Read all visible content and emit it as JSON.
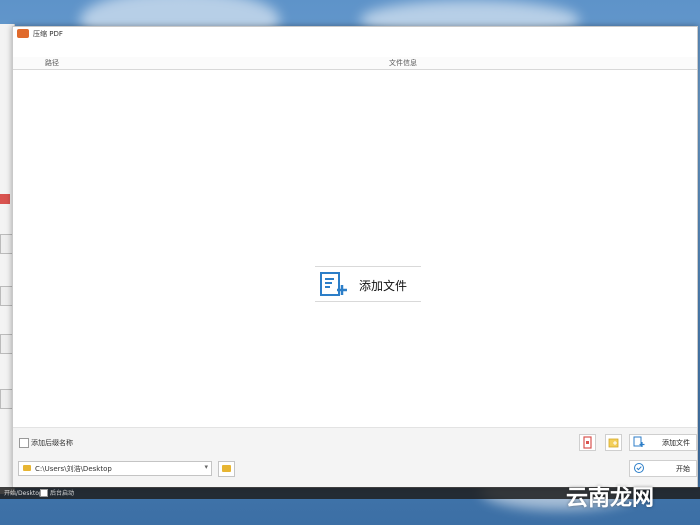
{
  "window": {
    "title": "压缩 PDF"
  },
  "list": {
    "col_path": "路径",
    "col_info": "文件信息"
  },
  "center": {
    "add_files_label": "添加文件"
  },
  "bottom": {
    "add_suffix_label": "添加后缀名称",
    "output_path": "C:\\Users\\刘浩\\Desktop",
    "add_files_button": "添加文件",
    "start_button": "开始"
  },
  "taskbar": {
    "left_text": "开始/Desktop",
    "checkbox_label": "后台启动"
  },
  "watermark": {
    "text": "云南龙网"
  },
  "colors": {
    "accent_blue": "#2c7ec8",
    "folder_yellow": "#e7b532",
    "app_orange": "#e06a2c"
  },
  "icons": {
    "add_files": "file-plus-icon",
    "folder": "folder-icon",
    "pdf_red": "pdf-icon",
    "folder_add": "folder-add-icon",
    "check": "check-circle-icon"
  }
}
